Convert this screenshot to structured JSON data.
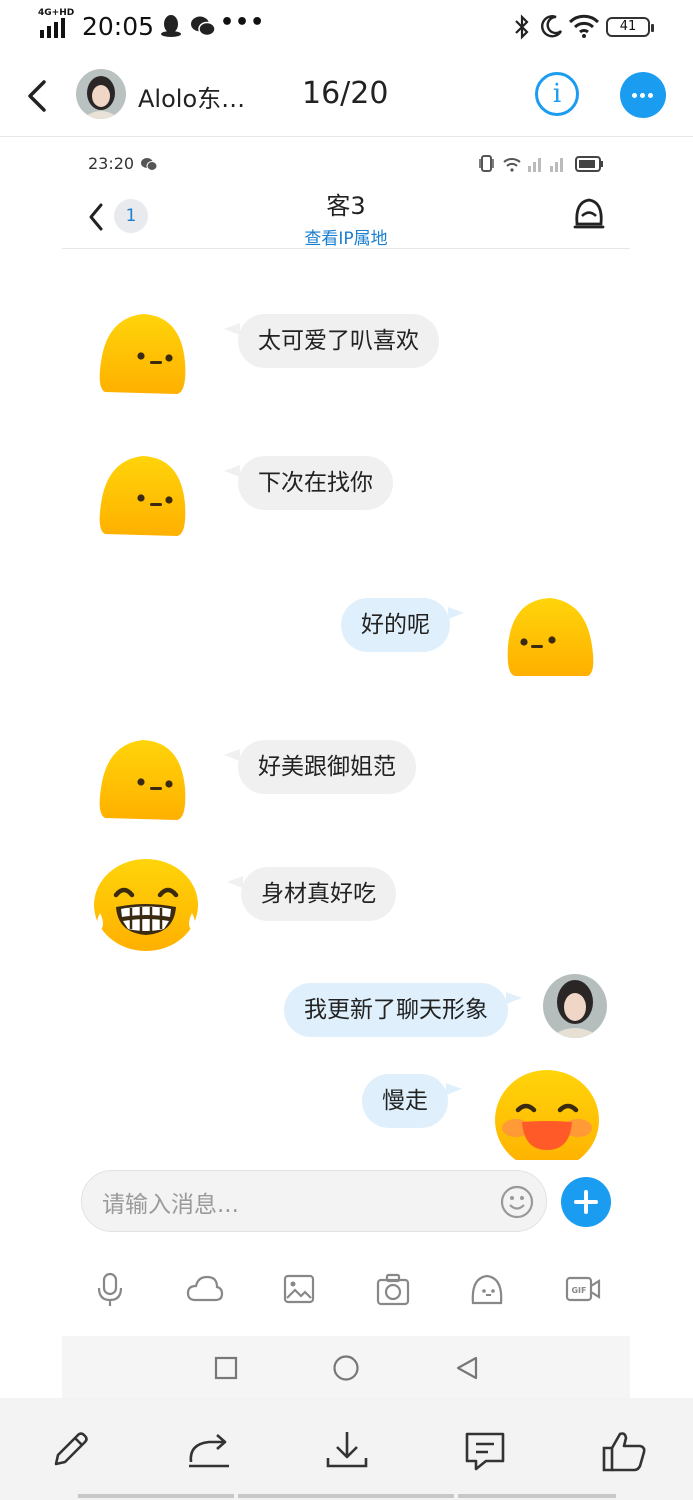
{
  "status_bar": {
    "network": "4G+HD",
    "time": "20:05",
    "battery": "41"
  },
  "header": {
    "contact_name": "Alolo东…",
    "page_counter": "16/20",
    "info_icon": "info-icon",
    "more_icon": "more-icon"
  },
  "inner_status": {
    "time": "23:20"
  },
  "chat_header": {
    "unread_badge": "1",
    "title": "客3",
    "ip_link": "查看IP属地"
  },
  "messages": [
    {
      "side": "left",
      "avatar": "neutral-emoji-avatar",
      "text": "太可爱了叭喜欢"
    },
    {
      "side": "left",
      "avatar": "neutral-emoji-avatar",
      "text": "下次在找你"
    },
    {
      "side": "right",
      "avatar": "neutral-emoji-avatar",
      "text": "好的呢"
    },
    {
      "side": "left",
      "avatar": "neutral-emoji-avatar",
      "text": "好美跟御姐范"
    },
    {
      "side": "left",
      "avatar": "laughing-tears-emoji-avatar",
      "text": "身材真好吃"
    },
    {
      "side": "right",
      "avatar": "photo-avatar",
      "text": "我更新了聊天形象"
    },
    {
      "side": "right",
      "avatar": "blushing-smile-emoji-avatar",
      "text": "慢走"
    }
  ],
  "composer": {
    "placeholder": "请输入消息..."
  },
  "toolbar_icons": [
    "mic-icon",
    "cloud-icon",
    "image-icon",
    "camera-icon",
    "emoji-icon",
    "gif-icon"
  ],
  "nav_icons": [
    "square-nav-icon",
    "circle-nav-icon",
    "triangle-nav-icon"
  ],
  "bottom_actions": [
    "edit-icon",
    "share-icon",
    "download-icon",
    "comment-icon",
    "like-icon"
  ],
  "colors": {
    "accent": "#1a9cf0",
    "emoji_yellow": "#ffc107",
    "left_bubble": "#f0f0f0",
    "right_bubble": "#dff0fc"
  }
}
